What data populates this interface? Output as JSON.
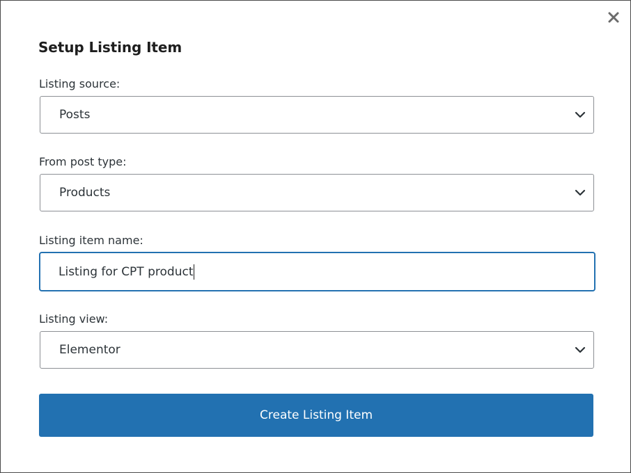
{
  "dialog": {
    "title": "Setup Listing Item",
    "close_icon": "close-icon"
  },
  "fields": {
    "listing_source": {
      "label": "Listing source:",
      "value": "Posts"
    },
    "post_type": {
      "label": "From post type:",
      "value": "Products"
    },
    "item_name": {
      "label": "Listing item name:",
      "value": "Listing for CPT product"
    },
    "listing_view": {
      "label": "Listing view:",
      "value": "Elementor"
    }
  },
  "actions": {
    "create_label": "Create Listing Item"
  },
  "colors": {
    "accent": "#2271b1",
    "border": "#8c8f94",
    "text": "#1e1e1e"
  }
}
